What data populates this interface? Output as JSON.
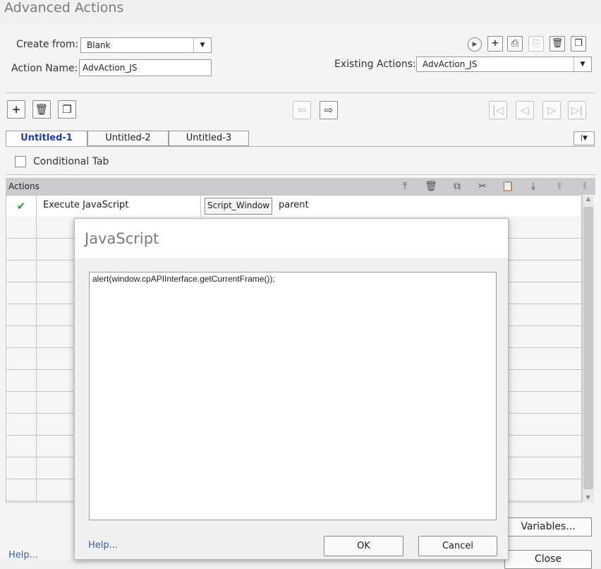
{
  "window": {
    "title": "Advanced Actions"
  },
  "top": {
    "create_from_label": "Create from:",
    "create_from_value": "Blank",
    "action_name_label": "Action Name:",
    "action_name_value": "AdvAction_JS",
    "existing_actions_label": "Existing Actions:",
    "existing_actions_value": "AdvAction_JS",
    "toolbar_icons": [
      "preview-icon",
      "add-icon",
      "save-as-template-icon",
      "import-icon",
      "delete-icon",
      "duplicate-icon"
    ]
  },
  "tabs": {
    "items": [
      {
        "label": "Untitled-1",
        "active": true
      },
      {
        "label": "Untitled-2",
        "active": false
      },
      {
        "label": "Untitled-3",
        "active": false
      }
    ]
  },
  "conditional": {
    "label": "Conditional Tab",
    "checked": false
  },
  "actions": {
    "header": "Actions",
    "rows": [
      {
        "action": "Execute JavaScript",
        "param_button": "Script_Window",
        "param_value": "parent",
        "valid": true
      }
    ]
  },
  "dialog": {
    "title": "JavaScript",
    "code": "alert(window.cpAPIInterface.getCurrentFrame());",
    "help": "Help...",
    "ok": "OK",
    "cancel": "Cancel"
  },
  "footer": {
    "variables": "Variables...",
    "help": "Help...",
    "close": "Close"
  },
  "colors": {
    "active_tab": "#1a3bb8",
    "check": "#2e9a2e",
    "link": "#3a5fa8"
  }
}
